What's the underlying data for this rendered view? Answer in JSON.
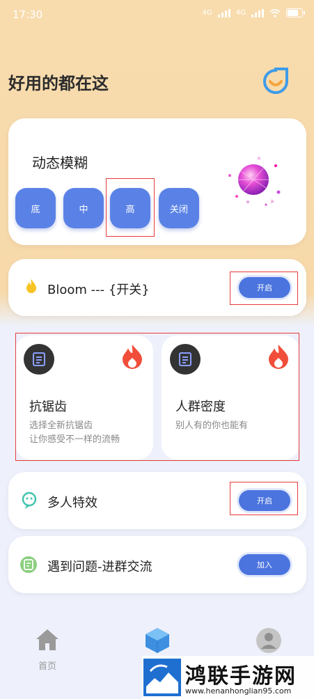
{
  "status_bar": {
    "time": "17:30",
    "net1": "4G",
    "net2": "4G"
  },
  "header": {
    "title": "好用的都在这"
  },
  "blur": {
    "title": "动态模糊",
    "levels": [
      "底",
      "中",
      "高",
      "关闭"
    ],
    "selected": "高"
  },
  "bloom": {
    "label": "Bloom --- {开关}",
    "toggle_label": "开启"
  },
  "features": [
    {
      "title": "抗锯齿",
      "desc1": "选择全新抗锯齿",
      "desc2": "让你感受不一样的流畅"
    },
    {
      "title": "人群密度",
      "desc1": "别人有的你也能有",
      "desc2": ""
    }
  ],
  "multi": {
    "label": "多人特效",
    "toggle_label": "开启"
  },
  "group": {
    "label": "遇到问题-进群交流",
    "button_label": "加入"
  },
  "nav": {
    "items": [
      {
        "label": "首页"
      },
      {
        "label": ""
      },
      {
        "label": ""
      }
    ]
  },
  "watermark": {
    "text": "鸿联手游网",
    "url": "www.henanhonglian95.com"
  },
  "colors": {
    "accent": "#5a82e6",
    "highlight": "#e53a3a",
    "background_top": "#f8dcae"
  }
}
